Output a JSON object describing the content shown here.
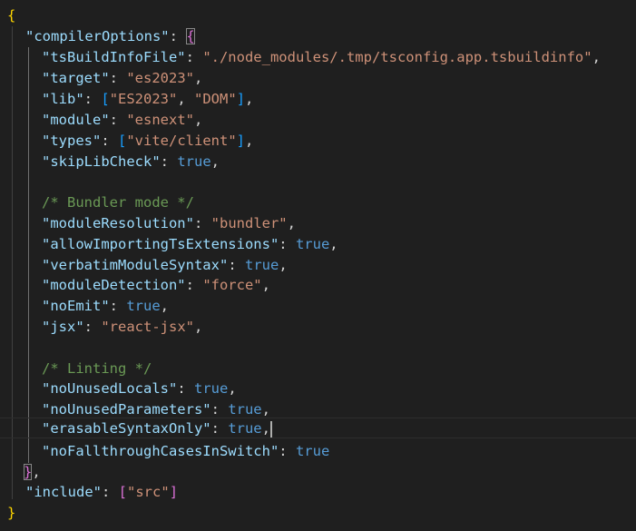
{
  "editor": {
    "colors": {
      "background": "#1f1f1f",
      "key": "#9cdcfe",
      "string": "#ce9178",
      "keyword": "#569cd6",
      "comment": "#6a9955",
      "punctuation": "#d4d4d4",
      "bracket_level1": "#ffd700",
      "bracket_level2": "#da70d6",
      "bracket_level3": "#179fff"
    },
    "lines": {
      "l0": {
        "brace": "{"
      },
      "l1": {
        "key": "\"compilerOptions\"",
        "sep": ": ",
        "brace": "{"
      },
      "l2": {
        "key": "\"tsBuildInfoFile\"",
        "sep": ": ",
        "value": "\"./node_modules/.tmp/tsconfig.app.tsbuildinfo\"",
        "end": ","
      },
      "l3": {
        "key": "\"target\"",
        "sep": ": ",
        "value": "\"es2023\"",
        "end": ","
      },
      "l4": {
        "key": "\"lib\"",
        "sep": ": ",
        "open": "[",
        "v1": "\"ES2023\"",
        "comma": ", ",
        "v2": "\"DOM\"",
        "close": "]",
        "end": ","
      },
      "l5": {
        "key": "\"module\"",
        "sep": ": ",
        "value": "\"esnext\"",
        "end": ","
      },
      "l6": {
        "key": "\"types\"",
        "sep": ": ",
        "open": "[",
        "v1": "\"vite/client\"",
        "close": "]",
        "end": ","
      },
      "l7": {
        "key": "\"skipLibCheck\"",
        "sep": ": ",
        "value": "true",
        "end": ","
      },
      "l9": {
        "comment": "/* Bundler mode */"
      },
      "l10": {
        "key": "\"moduleResolution\"",
        "sep": ": ",
        "value": "\"bundler\"",
        "end": ","
      },
      "l11": {
        "key": "\"allowImportingTsExtensions\"",
        "sep": ": ",
        "value": "true",
        "end": ","
      },
      "l12": {
        "key": "\"verbatimModuleSyntax\"",
        "sep": ": ",
        "value": "true",
        "end": ","
      },
      "l13": {
        "key": "\"moduleDetection\"",
        "sep": ": ",
        "value": "\"force\"",
        "end": ","
      },
      "l14": {
        "key": "\"noEmit\"",
        "sep": ": ",
        "value": "true",
        "end": ","
      },
      "l15": {
        "key": "\"jsx\"",
        "sep": ": ",
        "value": "\"react-jsx\"",
        "end": ","
      },
      "l17": {
        "comment": "/* Linting */"
      },
      "l18": {
        "key": "\"noUnusedLocals\"",
        "sep": ": ",
        "value": "true",
        "end": ","
      },
      "l19": {
        "key": "\"noUnusedParameters\"",
        "sep": ": ",
        "value": "true",
        "end": ","
      },
      "l20": {
        "key": "\"erasableSyntaxOnly\"",
        "sep": ": ",
        "value": "true",
        "end": ","
      },
      "l21": {
        "key": "\"noFallthroughCasesInSwitch\"",
        "sep": ": ",
        "value": "true"
      },
      "l22": {
        "brace": "}",
        "end": ","
      },
      "l23": {
        "key": "\"include\"",
        "sep": ": ",
        "open": "[",
        "v1": "\"src\"",
        "close": "]"
      },
      "l24": {
        "brace": "}"
      }
    }
  }
}
